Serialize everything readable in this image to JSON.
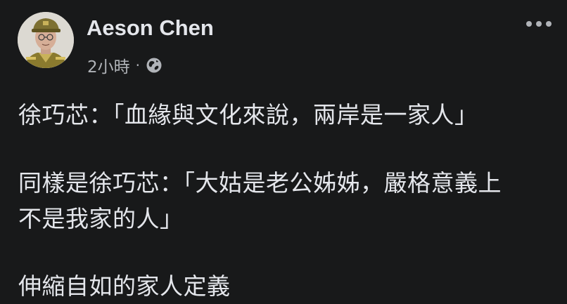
{
  "post": {
    "author": "Aeson Chen",
    "timestamp": "2小時",
    "separator": "·",
    "audience_icon": "globe-icon",
    "more_icon": "more-options-icon",
    "paragraphs": [
      [
        "徐巧芯：「血緣與文化來說，兩岸是一家人」"
      ],
      [
        "同樣是徐巧芯：「大姑是老公姊姊，嚴格意義上",
        "不是我家的人」"
      ],
      [
        "伸縮自如的家人定義"
      ]
    ]
  },
  "colors": {
    "background": "#18191a",
    "primary_text": "#e4e6eb",
    "secondary_text": "#b0b3b8"
  }
}
